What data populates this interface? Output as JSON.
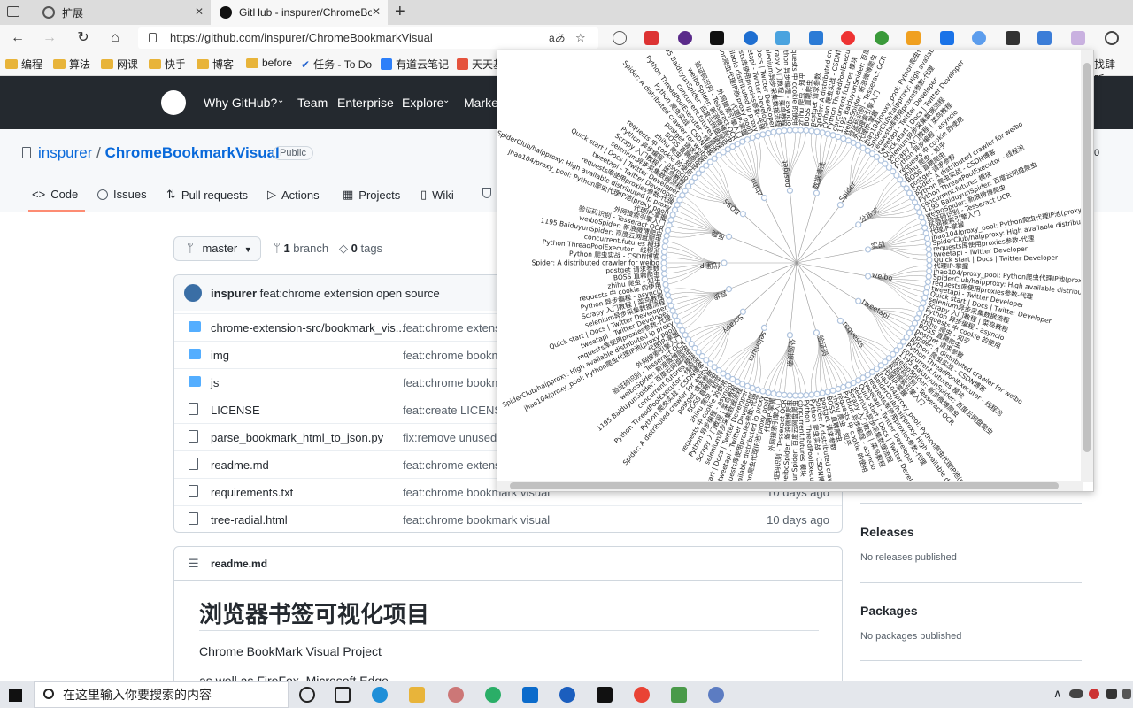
{
  "browser": {
    "tabs": [
      {
        "title": "扩展"
      },
      {
        "title": "GitHub - inspurer/ChromeBookm"
      }
    ],
    "new_tab_glyph": "+",
    "url": "https://github.com/inspurer/ChromeBookmarkVisual",
    "read_aloud_glyph": "aあ",
    "bookmarks": [
      "编程",
      "算法",
      "网课",
      "快手",
      "博客",
      "before",
      "任务 - To Do",
      "有道云笔记",
      "天天基",
      "找肆听..."
    ]
  },
  "github": {
    "nav": [
      "Why GitHub?",
      "Team",
      "Enterprise",
      "Explore",
      "Marke"
    ],
    "repo_owner": "inspurer",
    "repo_sep": "/",
    "repo_name": "ChromeBookmarkVisual",
    "visibility": "Public",
    "star_count": "0",
    "tabs": [
      "Code",
      "Issues",
      "Pull requests",
      "Actions",
      "Projects",
      "Wiki"
    ],
    "branch": "master",
    "branch_count": "1",
    "branch_label": "branch",
    "tag_count": "0",
    "tag_label": "tags",
    "commit_author": "inspurer",
    "commit_message": "feat:chrome extension open source",
    "files": [
      {
        "name": "chrome-extension-src/bookmark_vis...",
        "msg": "feat:chrome extensio",
        "date": "",
        "type": "dir"
      },
      {
        "name": "img",
        "msg": "feat:chrome bookmar",
        "date": "",
        "type": "dir"
      },
      {
        "name": "js",
        "msg": "feat:chrome bookma",
        "date": "",
        "type": "dir"
      },
      {
        "name": "LICENSE",
        "msg": "feat:create LICENSE",
        "date": "",
        "type": "file"
      },
      {
        "name": "parse_bookmark_html_to_json.py",
        "msg": "fix:remove unused ex",
        "date": "",
        "type": "file"
      },
      {
        "name": "readme.md",
        "msg": "feat:chrome extensio",
        "date": "",
        "type": "file"
      },
      {
        "name": "requirements.txt",
        "msg": "feat:chrome bookmark visual",
        "date": "10 days ago",
        "type": "file"
      },
      {
        "name": "tree-radial.html",
        "msg": "feat:chrome bookmark visual",
        "date": "10 days ago",
        "type": "file"
      }
    ],
    "readme_label": "readme.md",
    "readme_title": "浏览器书签可视化项目",
    "readme_line1": "Chrome BookMark Visual Project",
    "readme_line2": "as well as FireFox, Microsoft Edge",
    "releases_title": "Releases",
    "releases_sub": "No releases published",
    "packages_title": "Packages",
    "packages_sub": "No packages published"
  },
  "popup": {
    "branch_labels": [
      "weibo",
      "tweetapi",
      "requests",
      "验证码",
      "外网搜索",
      "selenium",
      "Scrapy",
      "异步",
      "代理IP",
      "反爬",
      "BOSS",
      "zhihu",
      "postget",
      "数据清洗",
      "Spider",
      "分布式",
      "实战"
    ],
    "leaf_labels": [
      "代理IP-掌握",
      "jhao104/proxy_pool: Python爬虫代理IP池(proxy pool)",
      "SpiderClub/haipproxy: High available distributed ip proxy",
      "requests库使用proxies参数-代理",
      "tweetapi - Twitter Developer",
      "Quick start | Docs | Twitter Developer",
      "selenium异步采集数据流程",
      "Scrapy 入门教程 | 菜鸟教程",
      "Python 异步编程 - asyncio",
      "requests 中 cookie 的使用",
      "zhihu 爬虫 - 知乎",
      "BOSS 直聘爬虫",
      "postget 请求参数",
      "Spider: A distributed crawler for weibo",
      "Python 爬虫实战 - CSDN博客",
      "Python ThreadPoolExecutor - 线程池",
      "concurrent.futures 模块",
      "1195 BaiduyunSpider: 百度云网盘爬虫",
      "weiboSpider: 新浪微博爬虫",
      "验证码识别 - Tesseract OCR",
      "外网搜索引擎入门"
    ]
  },
  "taskbar": {
    "search_placeholder": "在这里输入你要搜索的内容"
  },
  "colors": {
    "github_dark": "#24292f",
    "link": "#0969da",
    "folder": "#54aeff",
    "tab_underline": "#fd8c73",
    "node_fill": "#ffffff",
    "node_stroke": "#b0c4de",
    "link_line": "#999999"
  }
}
